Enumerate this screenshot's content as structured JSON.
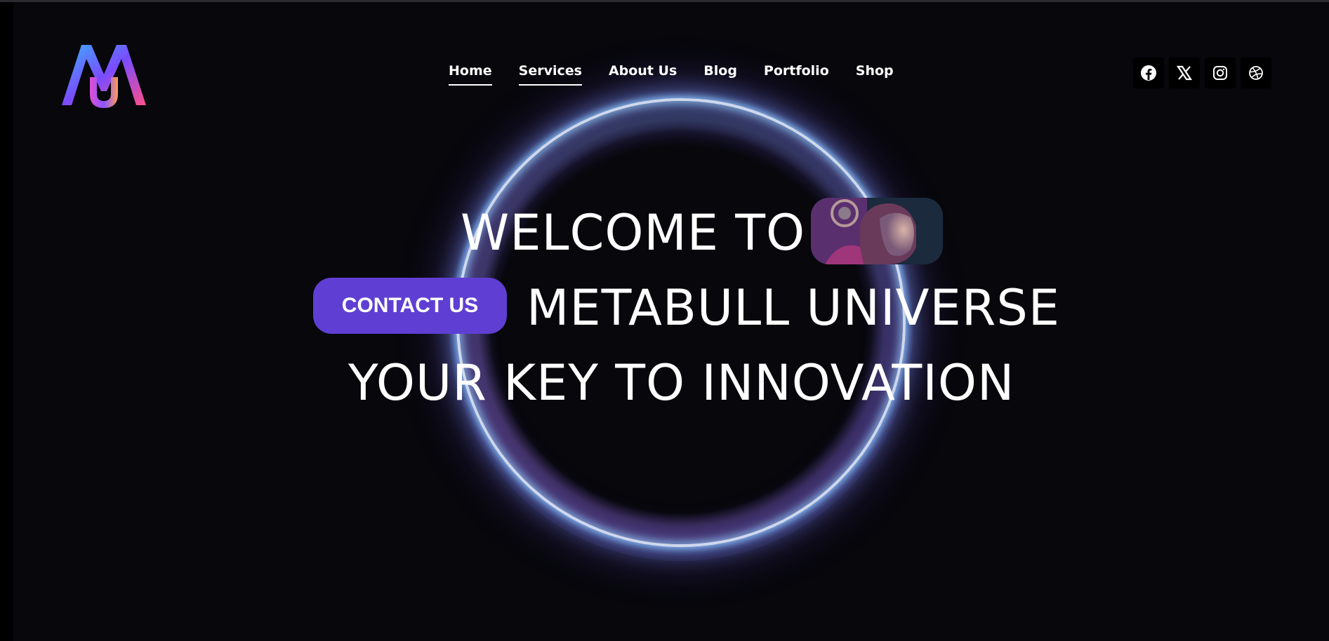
{
  "header": {
    "logo_alt": "MU"
  },
  "nav": {
    "items": [
      {
        "label": "Home",
        "active": true
      },
      {
        "label": "Services",
        "active": true
      },
      {
        "label": "About Us",
        "active": false
      },
      {
        "label": "Blog",
        "active": false
      },
      {
        "label": "Portfolio",
        "active": false
      },
      {
        "label": "Shop",
        "active": false
      }
    ]
  },
  "social": {
    "icons": [
      "facebook-icon",
      "x-icon",
      "instagram-icon",
      "dribbble-icon"
    ]
  },
  "hero": {
    "line1": "WELCOME TO",
    "line2": "METABULL UNIVERSE",
    "line3": "YOUR KEY TO INNOVATION",
    "cta_label": "CONTACT US"
  },
  "colors": {
    "background": "#07070c",
    "accent": "#5f3fd3",
    "text": "#ffffff"
  }
}
